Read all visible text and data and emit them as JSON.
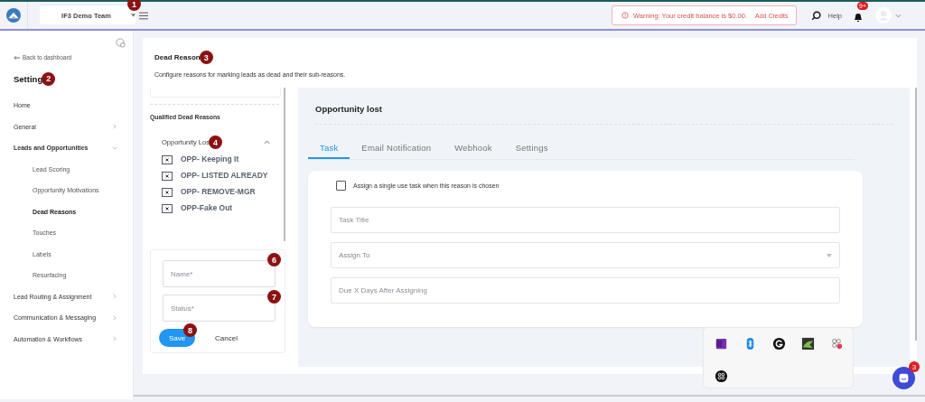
{
  "topbar": {
    "team_select": "IF3 Demo Team",
    "warning": "Warning: Your credit balance is $0.00.",
    "add_credits": "Add Credits",
    "help": "Help",
    "notification_count": "9+"
  },
  "sidebar": {
    "back_link": "Back to dashboard",
    "title": "Setting",
    "items": [
      {
        "label": "Home",
        "expandable": false
      },
      {
        "label": "General",
        "expandable": true,
        "expanded": false
      },
      {
        "label": "Leads and Opportunities",
        "expandable": true,
        "expanded": true,
        "children": [
          {
            "label": "Lead Scoring",
            "selected": false
          },
          {
            "label": "Opportunity Motivations",
            "selected": false
          },
          {
            "label": "Dead Reasons",
            "selected": true
          },
          {
            "label": "Touches",
            "selected": false
          },
          {
            "label": "Labels",
            "selected": false
          },
          {
            "label": "Resurfacing",
            "selected": false
          }
        ]
      },
      {
        "label": "Lead Routing & Assignment",
        "expandable": true,
        "expanded": false
      },
      {
        "label": "Communication & Messaging",
        "expandable": true,
        "expanded": false
      },
      {
        "label": "Automation & Workflows",
        "expandable": true,
        "expanded": false
      }
    ]
  },
  "page_header": {
    "title": "Dead Reason",
    "description": "Configure reasons for marking leads as dead and their sub-reasons."
  },
  "reasons_panel": {
    "section_title": "Qualified Dead Reasons",
    "group": {
      "label": "Opportunity Los",
      "expanded": true
    },
    "reasons": [
      "OPP- Keeping It",
      "OPP- LISTED ALREADY",
      "OPP- REMOVE-MGR",
      "OPP-Fake Out"
    ],
    "form": {
      "name_placeholder": "Name*",
      "status_placeholder": "Status*",
      "save": "Save",
      "cancel": "Cancel"
    }
  },
  "detail": {
    "heading": "Opportunity lost",
    "tabs": [
      {
        "label": "Task",
        "selected": true
      },
      {
        "label": "Email Notification",
        "selected": false
      },
      {
        "label": "Webhook",
        "selected": false
      },
      {
        "label": "Settings",
        "selected": false
      }
    ],
    "checkbox": {
      "label": "Assign a single use task when this reason is chosen",
      "checked": false
    },
    "fields": [
      {
        "kind": "text",
        "placeholder": "Task Title"
      },
      {
        "kind": "select",
        "placeholder": "Assign To"
      },
      {
        "kind": "text",
        "placeholder": "Due X Days After Assigning"
      }
    ]
  },
  "chat": {
    "badge": "3"
  },
  "markers": [
    "1",
    "2",
    "3",
    "4",
    "6",
    "7",
    "8"
  ]
}
